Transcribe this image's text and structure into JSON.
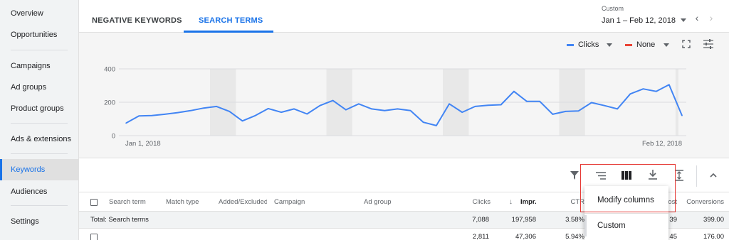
{
  "sidebar": {
    "items": [
      {
        "label": "Overview"
      },
      {
        "label": "Opportunities"
      },
      {
        "label": "Campaigns"
      },
      {
        "label": "Ad groups"
      },
      {
        "label": "Product groups"
      },
      {
        "label": "Ads & extensions"
      },
      {
        "label": "Keywords",
        "active": true
      },
      {
        "label": "Audiences"
      },
      {
        "label": "Settings"
      }
    ]
  },
  "tabs": [
    {
      "label": "NEGATIVE KEYWORDS"
    },
    {
      "label": "SEARCH TERMS",
      "active": true
    }
  ],
  "date_range": {
    "label": "Custom",
    "value": "Jan 1 – Feb 12, 2018"
  },
  "chart_controls": {
    "metric1": {
      "label": "Clicks",
      "color": "#4285f4"
    },
    "metric2": {
      "label": "None",
      "color": "#ea4335"
    }
  },
  "chart_data": {
    "type": "line",
    "x_start_label": "Jan 1, 2018",
    "x_end_label": "Feb 12, 2018",
    "ylim": [
      0,
      400
    ],
    "yticks": [
      "0",
      "200",
      "400"
    ],
    "grid": true,
    "series": [
      {
        "name": "Clicks",
        "color": "#4285f4",
        "values": [
          75,
          118,
          120,
          128,
          138,
          150,
          165,
          175,
          145,
          88,
          120,
          162,
          140,
          160,
          130,
          180,
          210,
          155,
          190,
          160,
          150,
          160,
          150,
          80,
          60,
          190,
          140,
          175,
          182,
          185,
          265,
          205,
          205,
          128,
          145,
          148,
          198,
          180,
          160,
          250,
          280,
          265,
          305,
          120
        ]
      }
    ],
    "weekend_bands": [
      [
        7,
        9
      ],
      [
        16,
        18
      ],
      [
        25,
        27
      ],
      [
        34,
        36
      ],
      [
        43,
        45
      ]
    ]
  },
  "toolbar": {
    "icons": [
      "filter-icon",
      "segment-icon",
      "columns-icon",
      "download-icon",
      "expand-icon",
      "collapse-icon"
    ]
  },
  "table": {
    "headers": [
      {
        "label": "Search term"
      },
      {
        "label": "Match type"
      },
      {
        "label": "Added/Excluded"
      },
      {
        "label": "Campaign"
      },
      {
        "label": "Ad group"
      },
      {
        "label": "Clicks"
      },
      {
        "label": "Impr."
      },
      {
        "label": "CTR"
      },
      {
        "label": "Cost"
      },
      {
        "label": "Conversions"
      }
    ],
    "total": {
      "label": "Total: Search terms",
      "clicks": "7,088",
      "impr": "197,958",
      "ctr": "3.58%",
      "cost": "39",
      "conversions": "399.00"
    },
    "row1": {
      "clicks": "2,811",
      "impr": "47,306",
      "ctr": "5.94%",
      "cost": "45",
      "conversions": "176.00"
    }
  },
  "dropdown": {
    "items": [
      {
        "label": "Modify columns"
      },
      {
        "label": "Custom"
      }
    ]
  },
  "colors": {
    "accent": "#1a73e8",
    "highlight": "#e53935"
  }
}
